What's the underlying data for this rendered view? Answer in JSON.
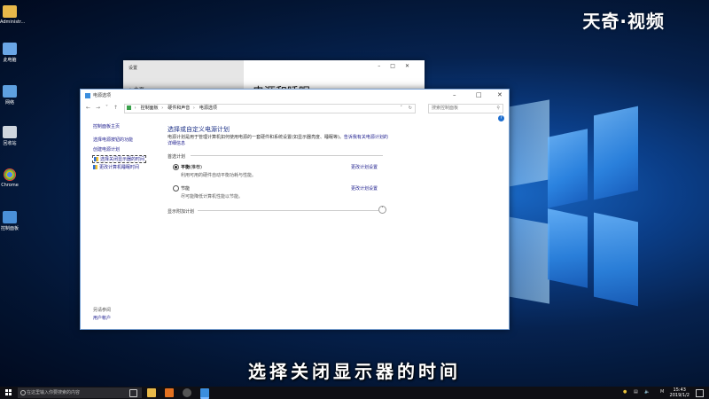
{
  "watermark": "天奇·视频",
  "subtitle": "选择关闭显示器的时间",
  "desktop_icons": [
    {
      "label": "Administr...",
      "icon": "user-folder-icon",
      "color": "#e8b84a"
    },
    {
      "label": "此电脑",
      "icon": "computer-icon",
      "color": "#6aa6e6"
    },
    {
      "label": "网络",
      "icon": "network-icon",
      "color": "#5ea0e0"
    },
    {
      "label": "回收站",
      "icon": "recycle-bin-icon",
      "color": "#cfd6de"
    },
    {
      "label": "Chrome",
      "icon": "chrome-icon",
      "color": "#e0452e"
    },
    {
      "label": "控制面板",
      "icon": "control-panel-icon",
      "color": "#4a90d9"
    }
  ],
  "settings_window": {
    "title": "设置",
    "home_label": "主页",
    "heading": "电源和睡眠"
  },
  "power_window": {
    "title": "电源选项",
    "breadcrumb": [
      "控制面板",
      "硬件和声音",
      "电源选项"
    ],
    "search_placeholder": "搜索控制面板",
    "left_nav": {
      "home": "控制面板主页",
      "power_button": "选择电源按钮的功能",
      "create_plan": "创建电源计划",
      "display_off": "选择关闭显示器的时间",
      "sleep_time": "更改计算机睡眠时间"
    },
    "see_also": "另请参阅",
    "user_accounts": "用户帐户",
    "main_title": "选择或自定义电源计划",
    "description": "电源计划是用于管理计算机如何使用电源的一套硬件和系统设置(如显示器亮度、睡眠等)。",
    "description_link": "告诉我有关电源计划的详细信息",
    "plans_section": "首选计划",
    "plans": [
      {
        "name": "平衡",
        "suffix": "(推荐)",
        "desc": "利用可用的硬件自动平衡功耗与性能。",
        "link": "更改计划设置",
        "selected": true
      },
      {
        "name": "节能",
        "suffix": "",
        "desc": "尽可能降低计算机性能以节能。",
        "link": "更改计划设置",
        "selected": false
      }
    ],
    "show_more": "显示附加计划"
  },
  "taskbar": {
    "search_placeholder": "在这里输入你要搜索的内容",
    "time": "15:43",
    "date": "2019/1/2"
  }
}
